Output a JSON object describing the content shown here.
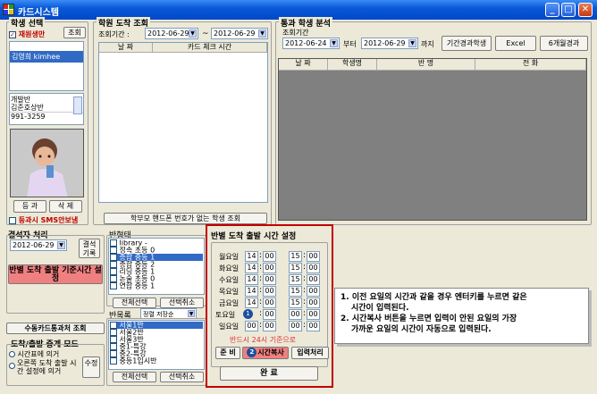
{
  "window": {
    "title": "카드시스템",
    "min": "_",
    "max": "□",
    "close": "✕"
  },
  "student_select": {
    "title": "학생 선택",
    "checkbox_label": "재원생만",
    "lookup": "조회",
    "selected_student": "김영희 kimhee",
    "class_label": "개발반",
    "teacher_label": "김준호상반",
    "phone": "991-3259",
    "register": "등 과",
    "delete": "삭 제",
    "sms_label": "등과시 SMS안보냄"
  },
  "arrival": {
    "title": "학원 도착 조회",
    "period_label": "조회기간 :",
    "date_from": "2012-06-29",
    "tilde": "~",
    "date_to": "2012-06-29",
    "col_date": "날 짜",
    "col_time": "카드 체크 시간",
    "bottom_button": "학부모 핸드폰 번호가 없는 학생 조회"
  },
  "stats": {
    "title": "통과 학생 분석",
    "period_label": "조회기간",
    "date_from": "2012-06-24",
    "from_label": "부터",
    "date_to": "2012-06-29",
    "to_label": "까지",
    "btn_period": "기간경과학생",
    "btn_excel": "Excel",
    "btn_6months": "6개월경과",
    "cols": [
      "날 짜",
      "학생명",
      "반 명",
      "전 화"
    ]
  },
  "absent": {
    "title": "결석자 처리",
    "date": "2012-06-29",
    "btn_record": "결석 기록",
    "btn_setting": "반별 도착 출발 기준시간 설정"
  },
  "class_filter": {
    "title": "반형태",
    "items": [
      "library -",
      "정속 초등 0",
      "종합 중등 1",
      "종합 중등 2",
      "리딩 중등 1",
      "논술 초등 0",
      "연합 중등 1"
    ],
    "checked": [
      false,
      false,
      true,
      false,
      false,
      false,
      false
    ],
    "selected_index": 2,
    "btn_all": "전체선택",
    "btn_cancel": "선택취소"
  },
  "class_list": {
    "title": "반목록",
    "sort": "정렬 저장순",
    "items": [
      "서울1반",
      "서울2반",
      "서울3반",
      "중1-특강",
      "중2-특강",
      "중등1입시반"
    ],
    "checked": [
      true,
      false,
      false,
      false,
      false,
      false
    ],
    "selected_index": 0,
    "btn_all": "전체선택",
    "btn_cancel": "선택취소"
  },
  "manual": {
    "button": "수동카드통과처 조회"
  },
  "relay_mode": {
    "title": "도착/출발 중계 모드",
    "opt1": "시간표에 의거",
    "opt2": "오른쪽 도착 출발 시간 설정에 의거",
    "btn_set": "수정"
  },
  "time_dialog": {
    "title": "반별 도착 출발 시간 설정",
    "days": [
      {
        "label": "월요일",
        "h1": "14",
        "m1": "00",
        "h2": "15",
        "m2": "00"
      },
      {
        "label": "화요일",
        "h1": "14",
        "m1": "00",
        "h2": "15",
        "m2": "00"
      },
      {
        "label": "수요일",
        "h1": "14",
        "m1": "00",
        "h2": "15",
        "m2": "00"
      },
      {
        "label": "목요일",
        "h1": "14",
        "m1": "00",
        "h2": "15",
        "m2": "00"
      },
      {
        "label": "금요일",
        "h1": "14",
        "m1": "00",
        "h2": "15",
        "m2": "00"
      },
      {
        "label": "토요일",
        "h1": "00",
        "m1": "00",
        "h2": "00",
        "m2": "00"
      },
      {
        "label": "일요일",
        "h1": "00",
        "m1": "00",
        "h2": "00",
        "m2": "00"
      }
    ],
    "warning": "반드시 24시 기준으로",
    "btn_prepare": "준 비",
    "btn_copy": "시간복사",
    "btn_input": "입력처리",
    "btn_done": "완 료",
    "badge1": "1",
    "badge2": "2"
  },
  "note": {
    "line1": "1. 이전 요일의 시간과 같을 경우 엔터키를 누르면 같은",
    "line1b": "시간이 입력된다.",
    "line2": "2. 시간복사 버튼을 누르면 입력이 안된 요일의 가장",
    "line2b": "가까운 요일의 시간이 자동으로 입력된다."
  },
  "colors": {
    "title_bar": "#0a5ad8",
    "highlight": "#316ac5",
    "dialog_border": "#c00000",
    "pink_button": "#f08080"
  }
}
